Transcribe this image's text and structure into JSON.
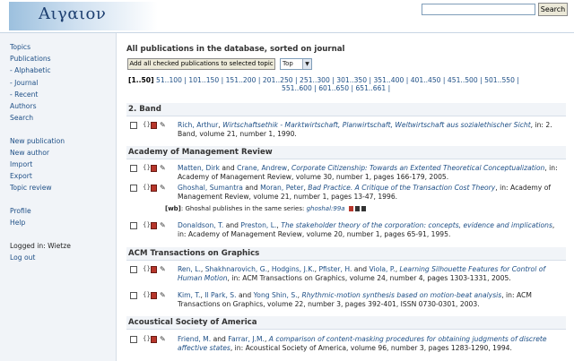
{
  "header": {
    "logo_text": "Αιγαιον",
    "search": {
      "value": "",
      "button_label": "Search"
    }
  },
  "sidebar": {
    "group1": [
      "Topics",
      "Publications",
      "- Alphabetic",
      "- Journal",
      "- Recent",
      "Authors",
      "Search"
    ],
    "group2": [
      "New publication",
      "New author",
      "Import",
      "Export",
      "Topic review"
    ],
    "group3": [
      "Profile",
      "Help"
    ],
    "logged_in": "Logged in: Wietze",
    "logout": "Log out"
  },
  "main": {
    "title": "All publications in the database, sorted on journal",
    "add_checked_label": "Add all checked publications to selected topic",
    "topic_select_value": "Top",
    "pager": {
      "current": "[1..50]",
      "pages_row1": [
        "51..100",
        "101..150",
        "151..200",
        "201..250",
        "251..300",
        "301..350",
        "351..400",
        "401..450",
        "451..500",
        "501..550"
      ],
      "pages_row2": [
        "551..600",
        "601..650",
        "651..661"
      ]
    },
    "sections": [
      {
        "name": "2. Band",
        "entries": [
          {
            "authors": "Rich, Arthur",
            "sep": ",",
            "title": "Wirtschaftsethik - Marktwirtschaft, Planwirtschaft, Weltwirtschaft aus sozialethischer Sicht",
            "rest": ", in: 2. Band, volume 21, number 1, 1990."
          }
        ]
      },
      {
        "name": "Academy of Management Review",
        "entries": [
          {
            "authors_html_parts": [
              "Matten, Dirk",
              " and ",
              "Crane, Andrew",
              ", "
            ],
            "title": "Corporate Citizenship: Towards an Extented Theoretical Conceptualization",
            "rest": ", in: Academy of Management Review, volume 30, number 1, pages 166-179, 2005."
          },
          {
            "authors_html_parts": [
              "Ghoshal, Sumantra",
              " and ",
              "Moran, Peter",
              ", "
            ],
            "title": "Bad Practice. A Critique of the Transaction Cost Theory",
            "rest": ", in: Academy of Management Review, volume 21, number 1, pages 13-47, 1996.",
            "note": {
              "label": "[wb]",
              "text": ": Ghoshal publishes in the same series: ",
              "ref": "ghoshal:99a"
            }
          },
          {
            "authors_html_parts": [
              "Donaldson, T.",
              " and ",
              "Preston, L.",
              ", "
            ],
            "title": "The stakeholder theory of the corporation: concepts, evidence and implications",
            "rest": ", in: Academy of Management Review, volume 20, number 1, pages 65-91, 1995."
          }
        ]
      },
      {
        "name": "ACM Transactions on Graphics",
        "entries": [
          {
            "authors_html_parts": [
              "Ren, L.",
              ", ",
              "Shakhnarovich, G.",
              ", ",
              "Hodgins, J.K.",
              ", ",
              "Pfister, H.",
              " and ",
              "Viola, P.",
              ", "
            ],
            "title": "Learning Silhouette Features for Control of Human Motion",
            "rest": ", in: ACM Transactions on Graphics, volume 24, number 4, pages 1303-1331, 2005."
          },
          {
            "authors_html_parts": [
              "Kim, T.",
              ", ",
              "Il Park, S.",
              " and ",
              "Yong Shin, S.",
              ", "
            ],
            "title": "Rhythmic-motion synthesis based on motion-beat analysis",
            "rest": ", in: ACM Transactions on Graphics, volume 22, number 3, pages 392-401, ISSN 0730-0301, 2003."
          }
        ]
      },
      {
        "name": "Acoustical Society of America",
        "entries": [
          {
            "authors_html_parts": [
              "Friend, M.",
              " and ",
              "Farrar, J.M.",
              ", "
            ],
            "title": "A comparison of content-masking procedures for obtaining judgments of discrete affective states",
            "rest": ", in: Acoustical Society of America, volume 96, number 3, pages 1283-1290, 1994."
          }
        ]
      }
    ]
  }
}
